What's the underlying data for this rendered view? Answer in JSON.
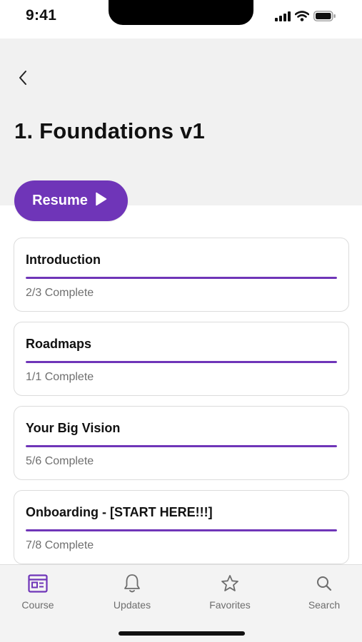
{
  "status_bar": {
    "time": "9:41",
    "icons": [
      "signal-icon",
      "wifi-icon",
      "battery-icon"
    ]
  },
  "header": {
    "back_icon": "chevron-left-icon",
    "title": "1. Foundations v1"
  },
  "resume_button": {
    "label": "Resume",
    "icon": "play-icon"
  },
  "modules": [
    {
      "name": "Introduction",
      "progress": "2/3 Complete",
      "fill_fraction": 1.0
    },
    {
      "name": "Roadmaps",
      "progress": "1/1 Complete",
      "fill_fraction": 1.0
    },
    {
      "name": "Your Big Vision",
      "progress": "5/6 Complete",
      "fill_fraction": 1.0
    },
    {
      "name": "Onboarding - [START HERE!!!]",
      "progress": "7/8 Complete",
      "fill_fraction": 1.0
    }
  ],
  "tab_bar": {
    "tabs": [
      {
        "label": "Course",
        "icon": "course-icon",
        "active": true
      },
      {
        "label": "Updates",
        "icon": "bell-icon",
        "active": false
      },
      {
        "label": "Favorites",
        "icon": "star-icon",
        "active": false
      },
      {
        "label": "Search",
        "icon": "search-icon",
        "active": false
      }
    ]
  },
  "colors": {
    "accent": "#6f35b8",
    "header_bg": "#f1f1f1",
    "tab_inactive": "#6d6d6d"
  }
}
